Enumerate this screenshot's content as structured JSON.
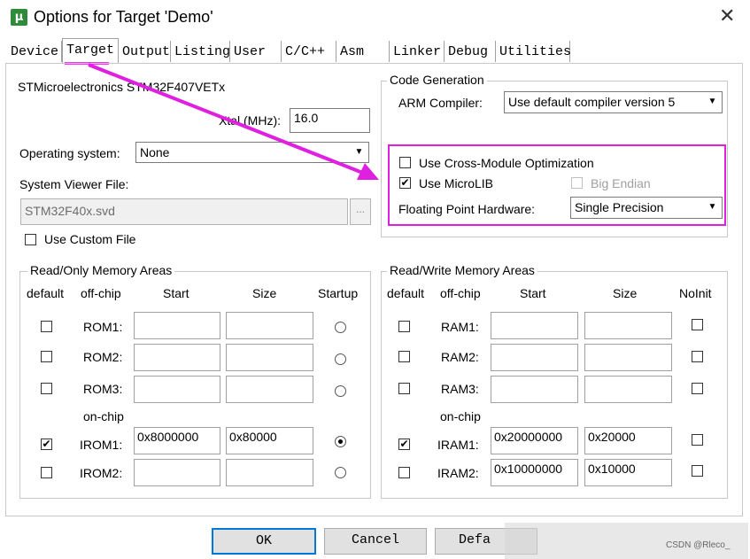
{
  "window": {
    "title": "Options for Target 'Demo'",
    "app_icon_glyph": "µ",
    "close_glyph": "✕"
  },
  "tabs": [
    {
      "label": "Device"
    },
    {
      "label": "Target"
    },
    {
      "label": "Output"
    },
    {
      "label": "Listing"
    },
    {
      "label": "User"
    },
    {
      "label": "C/C++"
    },
    {
      "label": "Asm"
    },
    {
      "label": "Linker"
    },
    {
      "label": "Debug"
    },
    {
      "label": "Utilities"
    }
  ],
  "active_tab": "Target",
  "target": {
    "device_name": "STMicroelectronics STM32F407VETx",
    "xtal_label": "Xtal (MHz):",
    "xtal_value": "16.0",
    "os_label": "Operating system:",
    "os_value": "None",
    "svf_label": "System Viewer File:",
    "svf_value": "STM32F40x.svd",
    "browse_label": "...",
    "custom_file_label": "Use Custom File",
    "custom_file_checked": false
  },
  "code_generation": {
    "title": "Code Generation",
    "compiler_label": "ARM Compiler:",
    "compiler_value": "Use default compiler version 5",
    "cross_module_label": "Use Cross-Module Optimization",
    "cross_module_checked": false,
    "microlib_label": "Use MicroLIB",
    "microlib_checked": true,
    "big_endian_label": "Big Endian",
    "big_endian_checked": false,
    "fph_label": "Floating Point Hardware:",
    "fph_value": "Single Precision"
  },
  "ro_memory": {
    "title": "Read/Only Memory Areas",
    "headers": {
      "default": "default",
      "offchip": "off-chip",
      "start": "Start",
      "size": "Size",
      "last": "Startup"
    },
    "onchip_label": "on-chip",
    "rows": [
      {
        "name": "ROM1:",
        "checked": false,
        "start": "",
        "size": "",
        "selected": false
      },
      {
        "name": "ROM2:",
        "checked": false,
        "start": "",
        "size": "",
        "selected": false
      },
      {
        "name": "ROM3:",
        "checked": false,
        "start": "",
        "size": "",
        "selected": false
      },
      {
        "name": "IROM1:",
        "checked": true,
        "start": "0x8000000",
        "size": "0x80000",
        "selected": true
      },
      {
        "name": "IROM2:",
        "checked": false,
        "start": "",
        "size": "",
        "selected": false
      }
    ]
  },
  "rw_memory": {
    "title": "Read/Write Memory Areas",
    "headers": {
      "default": "default",
      "offchip": "off-chip",
      "start": "Start",
      "size": "Size",
      "last": "NoInit"
    },
    "onchip_label": "on-chip",
    "rows": [
      {
        "name": "RAM1:",
        "checked": false,
        "start": "",
        "size": "",
        "noinit": false
      },
      {
        "name": "RAM2:",
        "checked": false,
        "start": "",
        "size": "",
        "noinit": false
      },
      {
        "name": "RAM3:",
        "checked": false,
        "start": "",
        "size": "",
        "noinit": false
      },
      {
        "name": "IRAM1:",
        "checked": true,
        "start": "0x20000000",
        "size": "0x20000",
        "noinit": false
      },
      {
        "name": "IRAM2:",
        "checked": false,
        "start": "0x10000000",
        "size": "0x10000",
        "noinit": false
      }
    ]
  },
  "buttons": {
    "ok": "OK",
    "cancel": "Cancel",
    "defaults": "Defa"
  },
  "watermark": "CSDN @Rleco_",
  "icons": {
    "dropdown": "▼",
    "check": "✔"
  },
  "colors": {
    "annotation": "#e020e0"
  }
}
